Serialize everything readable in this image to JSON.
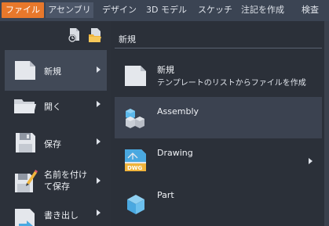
{
  "ribbon": {
    "tabs": [
      {
        "label": "ファイル"
      },
      {
        "label": "アセンブリ"
      },
      {
        "label": "デザイン"
      },
      {
        "label": "3D モデル"
      },
      {
        "label": "スケッチ"
      },
      {
        "label": "注記を作成"
      },
      {
        "label": "検査"
      }
    ]
  },
  "quick_access": {
    "icons": [
      "recent-documents-icon",
      "open-folder-icon"
    ]
  },
  "left_menu": {
    "items": [
      {
        "label": "新規",
        "icon": "new-document-icon"
      },
      {
        "label": "開く",
        "icon": "open-folder-icon"
      },
      {
        "label": "保存",
        "icon": "save-floppy-icon"
      },
      {
        "label_line1": "名前を付け",
        "label_line2": "て保存",
        "icon": "save-as-icon"
      },
      {
        "label": "書き出し",
        "icon": "export-icon"
      }
    ]
  },
  "submenu": {
    "heading": "新規",
    "items": [
      {
        "title": "新規",
        "subtitle": "テンプレートのリストからファイルを作成",
        "icon": "new-document-icon"
      },
      {
        "title": "Assembly",
        "icon": "assembly-icon"
      },
      {
        "title": "Drawing",
        "icon": "drawing-icon",
        "badge": "DWG"
      },
      {
        "title": "Part",
        "icon": "part-icon"
      }
    ]
  },
  "colors": {
    "file_tab": "#e8782b",
    "ribbon_bg": "#3b4453",
    "menu_bg": "#2a2f38",
    "selected": "#414957",
    "part_blue": "#4aa8e0"
  }
}
